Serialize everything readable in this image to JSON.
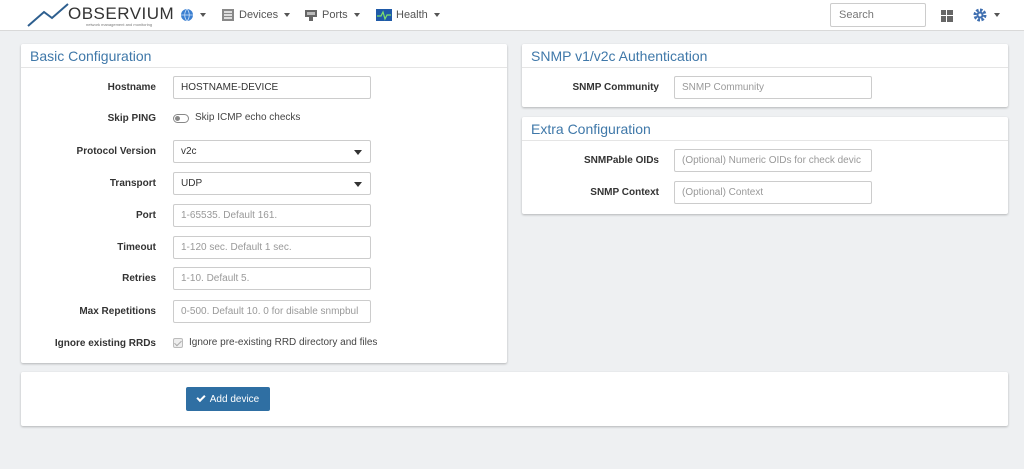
{
  "brand": {
    "name": "OBSERVIUM",
    "tagline": "network management and monitoring"
  },
  "nav": {
    "devices": "Devices",
    "ports": "Ports",
    "health": "Health",
    "search_placeholder": "Search"
  },
  "basic": {
    "title": "Basic Configuration",
    "hostname_label": "Hostname",
    "hostname_value": "HOSTNAME-DEVICE",
    "skip_ping_label": "Skip PING",
    "skip_ping_text": "Skip ICMP echo checks",
    "protocol_label": "Protocol Version",
    "protocol_value": "v2c",
    "transport_label": "Transport",
    "transport_value": "UDP",
    "port_label": "Port",
    "port_placeholder": "1-65535. Default 161.",
    "timeout_label": "Timeout",
    "timeout_placeholder": "1-120 sec. Default 1 sec.",
    "retries_label": "Retries",
    "retries_placeholder": "1-10. Default 5.",
    "maxrep_label": "Max Repetitions",
    "maxrep_placeholder": "0-500. Default 10. 0 for disable snmpbul",
    "ignore_label": "Ignore existing RRDs",
    "ignore_text": "Ignore pre-existing RRD directory and files"
  },
  "snmp_auth": {
    "title": "SNMP v1/v2c Authentication",
    "community_label": "SNMP Community",
    "community_placeholder": "SNMP Community"
  },
  "extra": {
    "title": "Extra Configuration",
    "oids_label": "SNMPable OIDs",
    "oids_placeholder": "(Optional) Numeric OIDs for check devic",
    "context_label": "SNMP Context",
    "context_placeholder": "(Optional) Context"
  },
  "actions": {
    "add_device": "Add device"
  },
  "colors": {
    "accent": "#3f78a9",
    "button": "#2f6fa3"
  }
}
